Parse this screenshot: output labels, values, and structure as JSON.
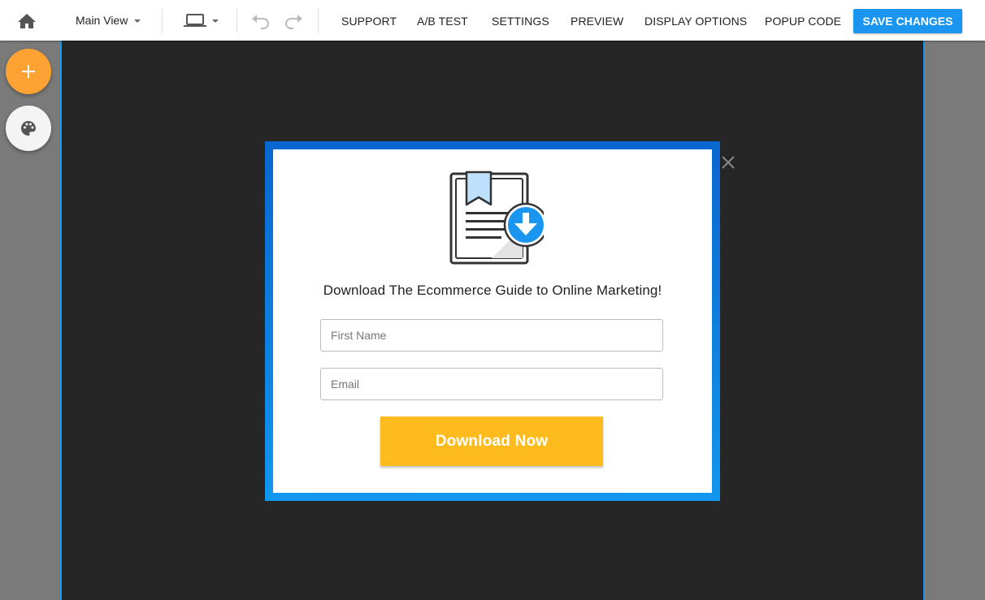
{
  "toolbar": {
    "view_label": "Main View",
    "links": {
      "support": "SUPPORT",
      "ab_test": "A/B TEST",
      "settings": "SETTINGS",
      "preview": "PREVIEW",
      "display_options": "DISPLAY OPTIONS",
      "popup_code": "POPUP CODE"
    },
    "save_label": "SAVE CHANGES",
    "icons": {
      "home": "home-icon",
      "device": "laptop-icon",
      "undo": "undo-icon",
      "redo": "redo-icon"
    }
  },
  "side_tools": {
    "add_icon": "plus-icon",
    "theme_icon": "palette-icon"
  },
  "popup": {
    "title": "Download The Ecommerce Guide to Online Marketing!",
    "first_name_placeholder": "First Name",
    "email_placeholder": "Email",
    "button_label": "Download Now",
    "illustration_icon": "ebook-download-icon",
    "close_icon": "close-icon"
  },
  "colors": {
    "accent": "#1a96f0",
    "add_button": "#ffa234",
    "cta_button": "#fdbb1d",
    "canvas": "#262626",
    "frame_top": "#0a66cf",
    "frame_bottom": "#1296ee"
  }
}
